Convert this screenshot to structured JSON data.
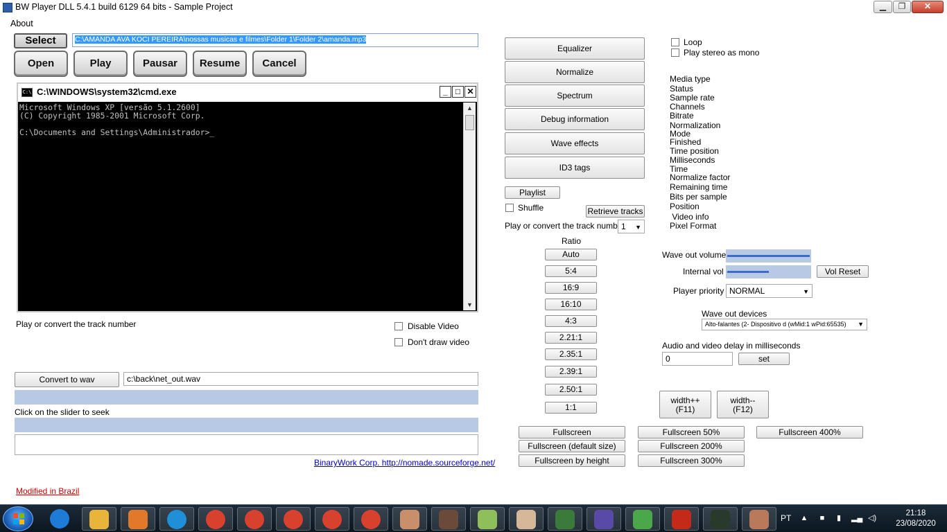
{
  "window": {
    "title": "BW Player DLL 5.4.1 build 6129 64 bits - Sample Project",
    "minimize": "▁",
    "maximize": "❐",
    "close": "✕"
  },
  "menu": {
    "about": "About"
  },
  "controls": {
    "select": "Select",
    "file_path": "C:\\AMANDA AVA KOCI PEREIRA\\nossas musicas e filmes\\Folder 1\\Folder 2\\amanda.mp3",
    "open": "Open",
    "play": "Play",
    "pause": "Pausar",
    "resume": "Resume",
    "cancel": "Cancel"
  },
  "cmd": {
    "title": "C:\\WINDOWS\\system32\\cmd.exe",
    "icon_text": "C:\\",
    "lines": "Microsoft Windows XP [versão 5.1.2600]\n(C) Copyright 1985-2001 Microsoft Corp.\n\nC:\\Documents and Settings\\Administrador>_",
    "btn_min": "_",
    "btn_max": "□",
    "btn_close": "✕"
  },
  "left": {
    "play_convert_label": "Play or convert the track number",
    "disable_video": "Disable Video",
    "dont_draw_video": "Don't draw video",
    "convert_btn": "Convert to wav",
    "convert_path": "c:\\back\\net_out.wav",
    "seek_label": "Click on the slider to seek",
    "link": "BinaryWork Corp. http://nomade.sourceforge.net/",
    "modified": "Modified in Brazil"
  },
  "middle": {
    "equalizer": "Equalizer",
    "normalize": "Normalize",
    "spectrum": "Spectrum",
    "debug": "Debug information",
    "wave_effects": "Wave effects",
    "id3": "ID3 tags",
    "playlist": "Playlist",
    "shuffle": "Shuffle",
    "retrieve": "Retrieve tracks",
    "track_label": "Play or convert the track number",
    "track_value": "1",
    "ratio_label": "Ratio",
    "ratios": [
      "Auto",
      "5:4",
      "16:9",
      "16:10",
      "4:3",
      "2.21:1",
      "2.35:1",
      "2.39:1",
      "2.50:1",
      "1:1"
    ]
  },
  "right": {
    "loop": "Loop",
    "stereo_mono": "Play stereo as mono",
    "info_labels": [
      "Media type",
      "Status",
      "Sample rate",
      "Channels",
      "Bitrate",
      "Normalization",
      "Mode",
      "Finished",
      "Time position",
      "Milliseconds",
      "Time",
      "Normalize factor",
      "Remaining time",
      "Bits per sample",
      "Position",
      " Video info",
      "Pixel Format"
    ],
    "wave_out_volume": "Wave out volume",
    "internal_vol": "Internal vol",
    "vol_reset": "Vol Reset",
    "player_priority": "Player priority",
    "priority_value": "NORMAL",
    "wave_out_devices": "Wave out devices",
    "device_value": "Alto-falantes (2- Dispositivo d (wMid:1 wPid:65535)",
    "delay_label": "Audio and video delay in milliseconds",
    "delay_value": "0",
    "set": "set",
    "width_plus_1": "width++",
    "width_plus_2": "(F11)",
    "width_minus_1": "width--",
    "width_minus_2": "(F12)"
  },
  "fullscreen": {
    "fs": "Fullscreen",
    "fs50": "Fullscreen 50%",
    "fs400": "Fullscreen 400%",
    "fs_default": "Fullscreen (default size)",
    "fs200": "Fullscreen 200%",
    "fs_height": "Fullscreen by height",
    "fs300": "Fullscreen 300%"
  },
  "levels": {
    "wave_out_volume": 1.0,
    "internal_vol": 0.5
  },
  "taskbar": {
    "lang": "PT",
    "time": "21:18",
    "date": "23/08/2020",
    "icons": [
      "ie-icon",
      "explorer-icon",
      "media-player-icon",
      "edge-icon",
      "chrome-icon",
      "chrome-icon",
      "chrome-icon",
      "chrome-icon",
      "chrome-icon",
      "photo-icon",
      "photo-icon",
      "notepadpp-icon",
      "photo-icon",
      "bug-icon",
      "eclipse-icon",
      "puzzle-icon",
      "filezilla-icon",
      "terminal-icon",
      "photo-icon"
    ],
    "icon_colors": [
      "#1e7bd6",
      "#e8b53a",
      "#e07a2a",
      "#1f8fd8",
      "#d9412f",
      "#d9412f",
      "#d9412f",
      "#d9412f",
      "#d9412f",
      "#c98e6a",
      "#6b4a3a",
      "#8fbf5a",
      "#d6b79a",
      "#3a7a3a",
      "#5a4aa8",
      "#4aa84a",
      "#c42a1a",
      "#2a3a2a",
      "#b87a5a"
    ]
  }
}
